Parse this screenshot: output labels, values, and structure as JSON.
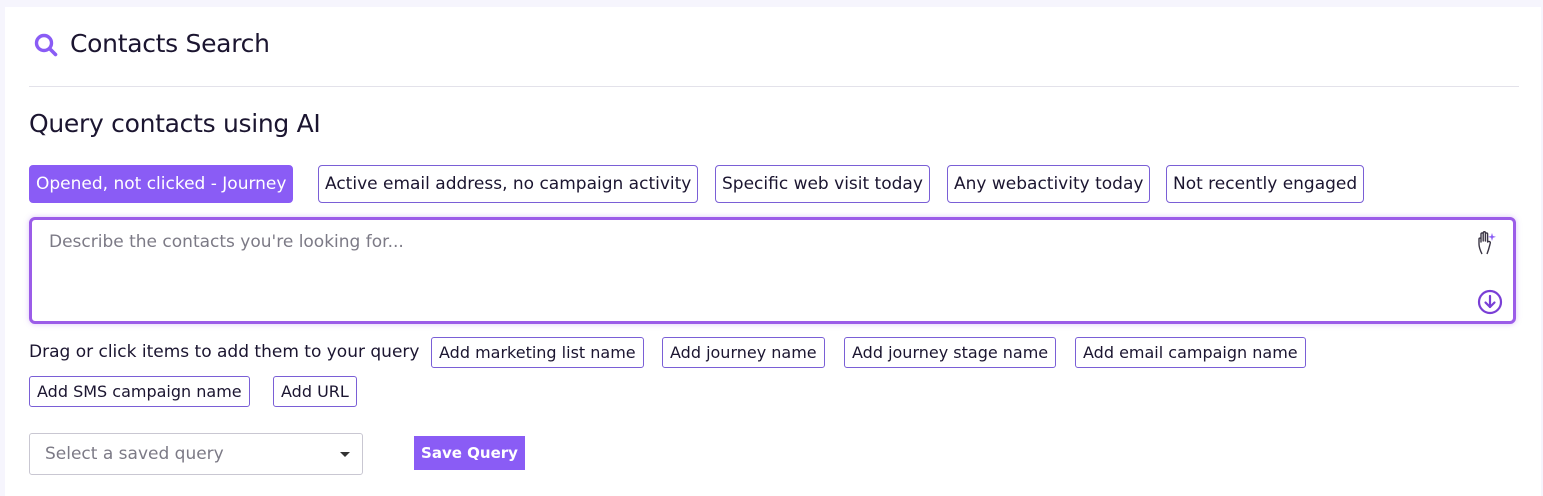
{
  "header": {
    "title": "Contacts Search",
    "icon": "search-icon"
  },
  "section": {
    "heading": "Query contacts using AI"
  },
  "suggestions": [
    {
      "label": "Opened, not clicked - Journey",
      "active": true
    },
    {
      "label": "Active email address, no campaign activity",
      "active": false
    },
    {
      "label": "Specific web visit today",
      "active": false
    },
    {
      "label": "Any webactivity today",
      "active": false
    },
    {
      "label": "Not recently engaged",
      "active": false
    }
  ],
  "query": {
    "placeholder": "Describe the contacts you're looking for...",
    "value": "",
    "assist_icon": "hand-sparkle-icon",
    "submit_icon": "arrow-down-circle-icon"
  },
  "drag": {
    "label": "Drag or click items to add them to your query",
    "items": [
      "Add marketing list name",
      "Add journey name",
      "Add journey stage name",
      "Add email campaign name",
      "Add SMS campaign name",
      "Add URL"
    ]
  },
  "saved_query": {
    "placeholder": "Select a saved query"
  },
  "actions": {
    "save_label": "Save Query"
  },
  "colors": {
    "accent": "#8a5cf5",
    "border": "#7a5fd6",
    "text": "#1b1530"
  }
}
